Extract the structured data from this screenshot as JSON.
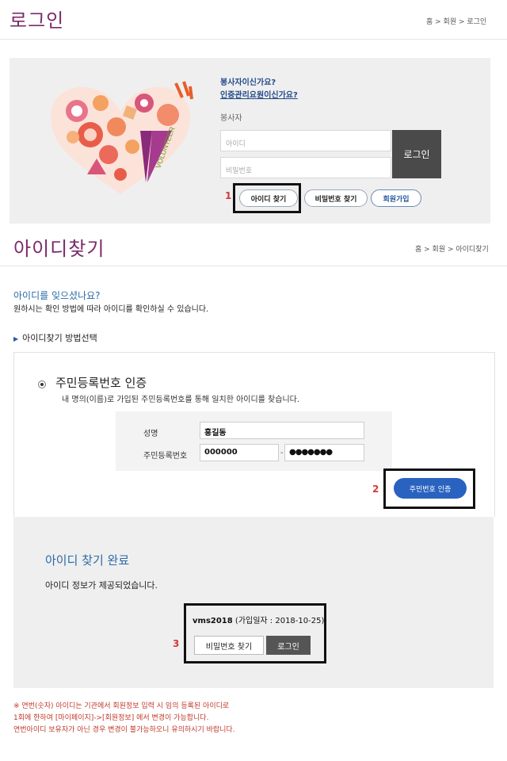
{
  "login_section": {
    "title": "로그인",
    "breadcrumb": [
      "홈",
      "회원",
      "로그인"
    ],
    "question_volunteer": "봉사자이신가요?",
    "question_manager": "인증관리요원이신가요?",
    "user_type": "봉사자",
    "id_placeholder": "아이디",
    "pw_placeholder": "비밀번호",
    "login_button": "로그인",
    "find_id_button": "아이디 찾기",
    "find_pw_button": "비밀번호 찾기",
    "signup_button": "회원가입",
    "logo_text": "VOLUNTEER"
  },
  "find_id_section": {
    "title": "아이디찾기",
    "breadcrumb": [
      "홈",
      "회원",
      "아이디찾기"
    ],
    "question": "아이디를 잊으셨나요?",
    "description": "원하시는 확인 방법에 따라 아이디를 확인하실 수 있습니다.",
    "method_heading": "아이디찾기 방법선택",
    "auth_title": "주민등록번호 인증",
    "auth_desc": "내 명의(이름)로 가입된 주민등록번호를 통해 일치한 아이디를 찾습니다.",
    "name_label": "성명",
    "name_value": "홍길동",
    "rrn_label": "주민등록번호",
    "rrn_first": "000000",
    "rrn_dash": "-",
    "rrn_second": "●●●●●●●",
    "verify_button": "주민번호 인증"
  },
  "result_section": {
    "title": "아이디 찾기 완료",
    "description": "아이디 정보가 제공되었습니다.",
    "user_id": "vms2018",
    "join_date_text": "(가입일자 : 2018-10-25)",
    "find_pw_button": "비밀번호 찾기",
    "login_button": "로그인"
  },
  "notes": [
    "※ 연번(숫자) 아이디는 기관에서 회원정보 입력 시 임의 등록된 아이디로",
    "1회에 한하여 [마이페이지]->[회원정보] 에서 변경이 가능합니다.",
    "연번아이디 보유자가 아닌 경우 변경이 불가능하오니 유의하시기 바랍니다."
  ],
  "callouts": [
    "1",
    "2",
    "3"
  ],
  "colors": {
    "title_purple": "#7a2a6a",
    "accent_blue": "#2a62c0",
    "note_red": "#c0392b",
    "callout_red": "#d23a3a"
  }
}
